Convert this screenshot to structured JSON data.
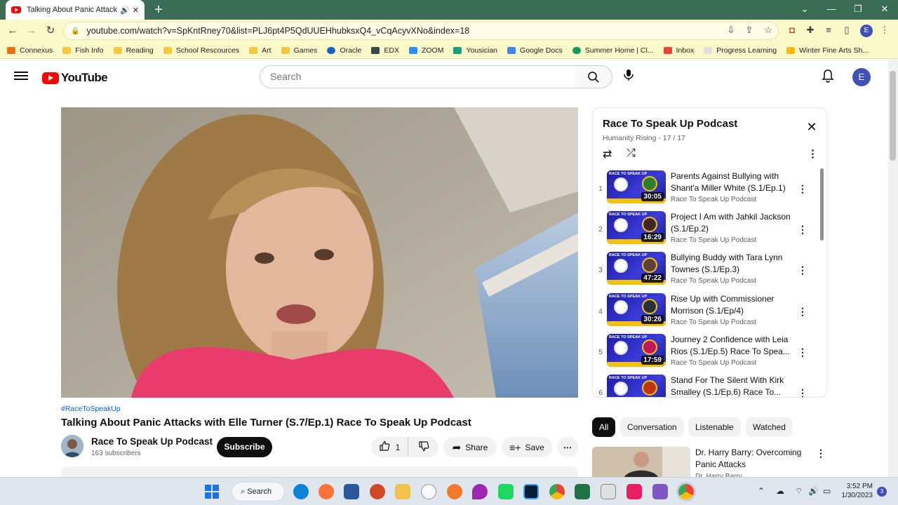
{
  "browser": {
    "tab_title": "Talking About Panic Attacks w",
    "url": "youtube.com/watch?v=SpKntRney70&list=PLJ6pt4P5QdUUEHhubksxQ4_vCqAcyvXNo&index=18",
    "profile_initial": "E",
    "bookmarks": [
      "Connexus",
      "Fish Info",
      "Reading",
      "School Rescources",
      "Art",
      "Games",
      "Oracle",
      "EDX",
      "ZOOM",
      "Yousician",
      "Google Docs",
      "Summer Home | Cl...",
      "Inbox",
      "Progress Learning",
      "Winter Fine Arts Sh..."
    ]
  },
  "youtube": {
    "logo_text": "YouTube",
    "search_placeholder": "Search",
    "avatar_initial": "E"
  },
  "video": {
    "hashtag": "#RaceToSpeakUp",
    "title": "Talking About Panic Attacks with Elle Turner (S.7/Ep.1) Race To Speak Up Podcast",
    "channel": "Race To Speak Up Podcast",
    "subscribers": "163 subscribers",
    "subscribe_label": "Subscribe",
    "like_count": "1",
    "share_label": "Share",
    "save_label": "Save"
  },
  "playlist": {
    "title": "Race To Speak Up Podcast",
    "subtitle": "Humanity Rising - 17 / 17",
    "items": [
      {
        "num": "1",
        "title": "Parents Against Bullying with Shant'a Miller White (S.1/Ep.1)",
        "channel": "Race To Speak Up Podcast",
        "duration": "30:05"
      },
      {
        "num": "2",
        "title": "Project I Am with Jahkil Jackson (S.1/Ep.2)",
        "channel": "Race To Speak Up Podcast",
        "duration": "16:29"
      },
      {
        "num": "3",
        "title": "Bullying Buddy with Tara Lynn Townes (S.1/Ep.3)",
        "channel": "Race To Speak Up Podcast",
        "duration": "47:22"
      },
      {
        "num": "4",
        "title": "Rise Up with Commissioner Morrison (S.1/Ep/4)",
        "channel": "Race To Speak Up Podcast",
        "duration": "30:26"
      },
      {
        "num": "5",
        "title": "Journey 2 Confidence with Leia Rios (S.1/Ep.5) Race To Spea...",
        "channel": "Race To Speak Up Podcast",
        "duration": "17:59"
      },
      {
        "num": "6",
        "title": "Stand For The Silent With Kirk Smalley (S.1/Ep.6) Race To...",
        "channel": "Race To Speak Up Podcast",
        "duration": ""
      }
    ]
  },
  "chips": [
    "All",
    "Conversation",
    "Listenable",
    "Watched"
  ],
  "recommendation": {
    "title": "Dr. Harry Barry: Overcoming Panic Attacks",
    "channel": "Dr. Harry Barry"
  },
  "taskbar": {
    "search_label": "Search",
    "time": "3:52 PM",
    "date": "1/30/2023",
    "badge": "3"
  },
  "colors": {
    "chrome_frame": "#3a6b55",
    "toolbar": "#f9f9c9",
    "yt_red": "#ff0000",
    "link_blue": "#065fd4"
  }
}
